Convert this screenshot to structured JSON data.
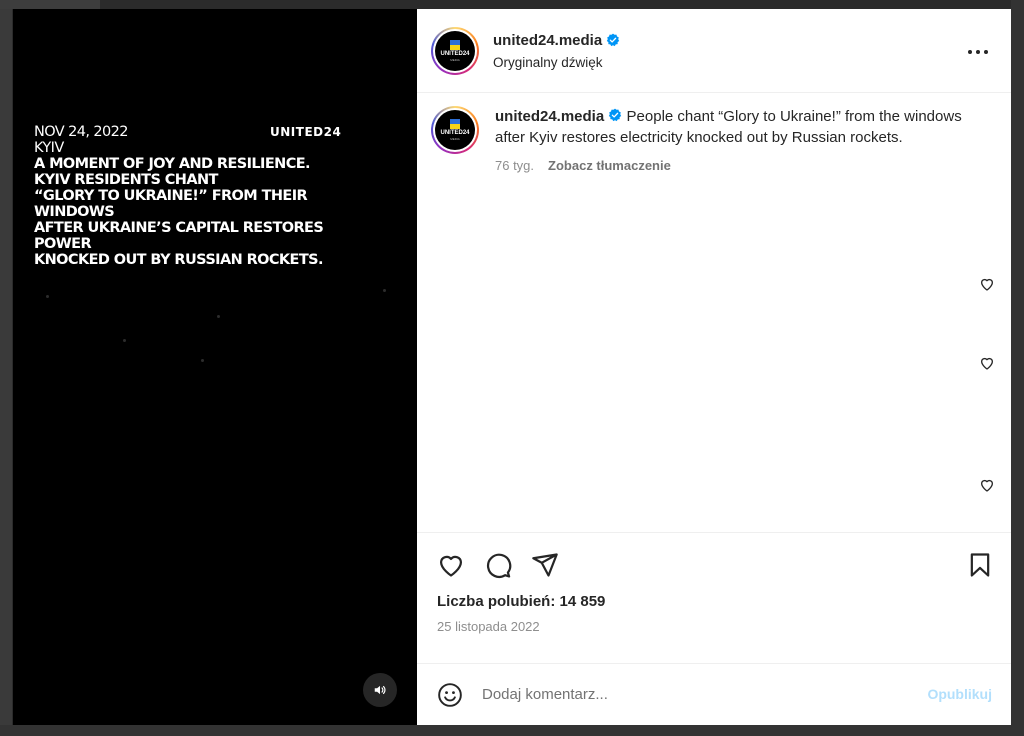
{
  "post": {
    "username": "united24.media",
    "audio_label": "Oryginalny dźwięk",
    "more_icon": "more-horizontal-icon",
    "verified_color": "#0095f6",
    "avatar": {
      "wordmark": "UNITED24",
      "subtitle": "MEDIA"
    }
  },
  "media": {
    "overlay_date": "NOV 24, 2022",
    "overlay_city": "KYIV",
    "overlay_headline_lines": [
      "A MOMENT OF JOY AND RESILIENCE.",
      "KYIV RESIDENTS CHANT",
      "“GLORY TO UKRAINE!” FROM THEIR WINDOWS",
      "AFTER UKRAINE’S CAPITAL RESTORES POWER",
      "KNOCKED OUT BY RUSSIAN ROCKETS."
    ],
    "brand_logo": "UNITED24",
    "sound_icon": "speaker-icon"
  },
  "caption": {
    "username": "united24.media",
    "text": "People chant “Glory to Ukraine!” from the windows after Kyiv restores electricity knocked out by Russian rockets.",
    "age": "76 tyg.",
    "translate_label": "Zobacz tłumaczenie"
  },
  "actions": {
    "like_icon": "heart-icon",
    "comment_icon": "comment-icon",
    "share_icon": "send-icon",
    "save_icon": "bookmark-icon"
  },
  "likes_text": "Liczba polubień: 14 859",
  "date_text": "25 listopada 2022",
  "comment": {
    "placeholder": "Dodaj komentarz...",
    "publish_label": "Opublikuj",
    "publish_color": "#b2dffc",
    "emoji_icon": "emoji-icon"
  }
}
